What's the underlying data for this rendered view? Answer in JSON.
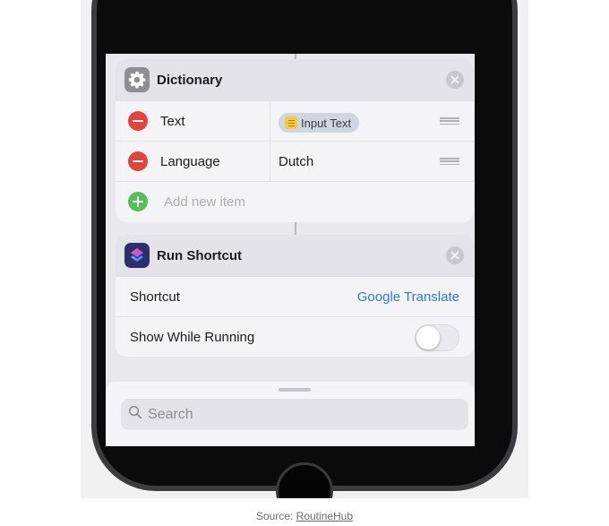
{
  "dictionary_card": {
    "title": "Dictionary",
    "rows": [
      {
        "key": "Text",
        "value": "Input Text",
        "value_type": "variable-pill"
      },
      {
        "key": "Language",
        "value": "Dutch",
        "value_type": "text"
      }
    ],
    "add_item_label": "Add new item"
  },
  "run_shortcut_card": {
    "title": "Run Shortcut",
    "shortcut_label": "Shortcut",
    "shortcut_value": "Google Translate",
    "show_while_running_label": "Show While Running",
    "show_while_running_on": false
  },
  "search": {
    "placeholder": "Search"
  },
  "caption": {
    "prefix": "Source: ",
    "link_text": "RoutineHub"
  },
  "colors": {
    "remove": "#e0443b",
    "add": "#52c158",
    "link": "#2e7bdb"
  },
  "icons": [
    "gear-icon",
    "shortcuts-icon",
    "close-icon",
    "minus-icon",
    "plus-icon",
    "drag-handle-icon",
    "variable-icon",
    "search-icon"
  ]
}
